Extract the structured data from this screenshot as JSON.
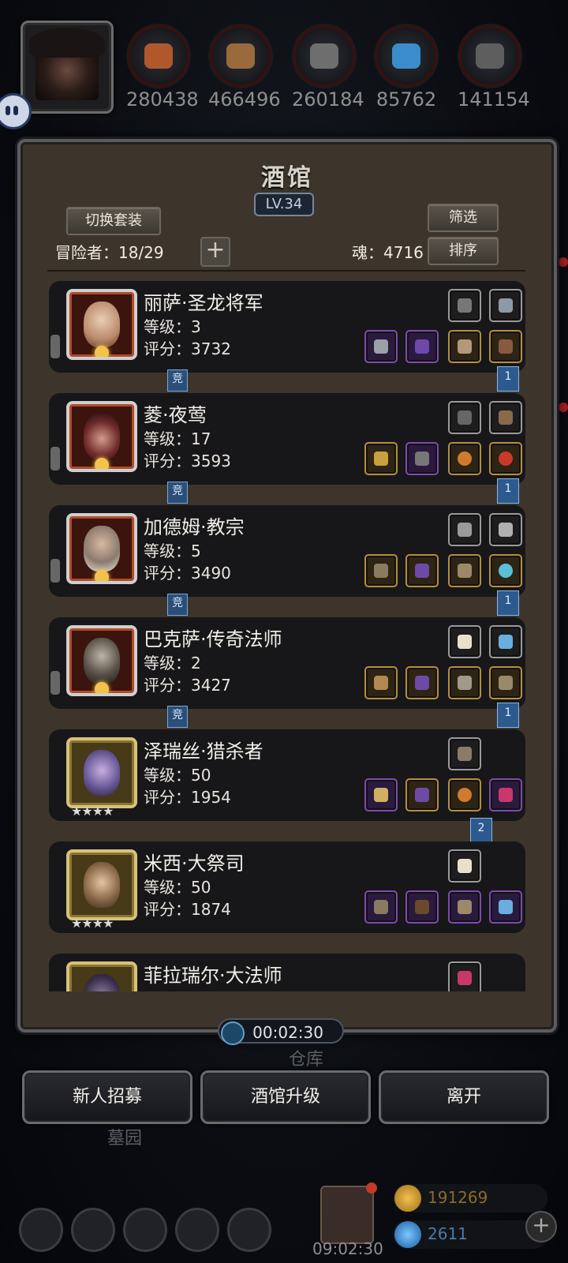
{
  "resources": [
    {
      "icon": "meat-icon",
      "value": "280438",
      "color": "#b0582c"
    },
    {
      "icon": "wood-icon",
      "value": "466496",
      "color": "#9a6a3c"
    },
    {
      "icon": "iron-icon",
      "value": "260184",
      "color": "#6e6e6e"
    },
    {
      "icon": "crystal-icon",
      "value": "85762",
      "color": "#3a8ccc"
    },
    {
      "icon": "stone-icon",
      "value": "141154",
      "color": "#5e5e5e"
    }
  ],
  "panel": {
    "title": "酒馆",
    "level": "LV.34",
    "switch_outfit": "切换套装",
    "filter": "筛选",
    "sort": "排序",
    "adventurers_label": "冒险者：18/29",
    "soul_label": "魂：4716"
  },
  "heroes": [
    {
      "name": "丽萨·圣龙将军",
      "level": "等级：3",
      "score": "评分：3732",
      "tag": "竞",
      "ribbon": "1",
      "rarity": "red"
    },
    {
      "name": "菱·夜莺",
      "level": "等级：17",
      "score": "评分：3593",
      "tag": "竞",
      "ribbon": "1",
      "rarity": "red"
    },
    {
      "name": "加德姆·教宗",
      "level": "等级：5",
      "score": "评分：3490",
      "tag": "竞",
      "ribbon": "1",
      "rarity": "red"
    },
    {
      "name": "巴克萨·传奇法师",
      "level": "等级：2",
      "score": "评分：3427",
      "tag": "竞",
      "ribbon": "1",
      "rarity": "red"
    },
    {
      "name": "泽瑞丝·猎杀者",
      "level": "等级：50",
      "score": "评分：1954",
      "stars": "★★★★",
      "ribbon": "2",
      "rarity": "gold"
    },
    {
      "name": "米西·大祭司",
      "level": "等级：50",
      "score": "评分：1874",
      "stars": "★★★★",
      "rarity": "gold"
    },
    {
      "name": "菲拉瑞尔·大法师",
      "rarity": "gold"
    }
  ],
  "timer": "00:02:30",
  "buttons": {
    "recruit": "新人招募",
    "upgrade": "酒馆升级",
    "leave": "离开"
  },
  "background_labels": {
    "cemetery": "墓园",
    "warehouse": "仓库"
  },
  "bottom": {
    "time": "09:02:30",
    "gold": "191269",
    "gems": "2611"
  }
}
